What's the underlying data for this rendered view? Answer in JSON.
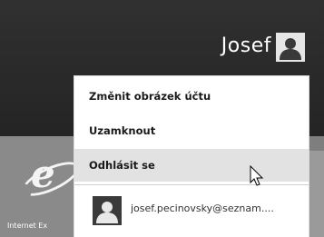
{
  "user": {
    "name": "Josef",
    "avatar_icon": "user-avatar-icon"
  },
  "menu": {
    "items": [
      {
        "label": "Změnit obrázek účtu"
      },
      {
        "label": "Uzamknout"
      },
      {
        "label": "Odhlásit se",
        "state": "hover"
      }
    ],
    "account": {
      "email": "josef.pecinovsky@seznam....",
      "avatar_icon": "account-avatar-icon"
    }
  },
  "tiles": {
    "ie_label": "Internet Ex",
    "ie_icon": "internet-explorer-icon"
  },
  "colors": {
    "background": "#2a2a2a",
    "menu_bg": "#ffffff",
    "hover_bg": "#e2e2e2",
    "tile_gray": "#8a8a8a"
  }
}
